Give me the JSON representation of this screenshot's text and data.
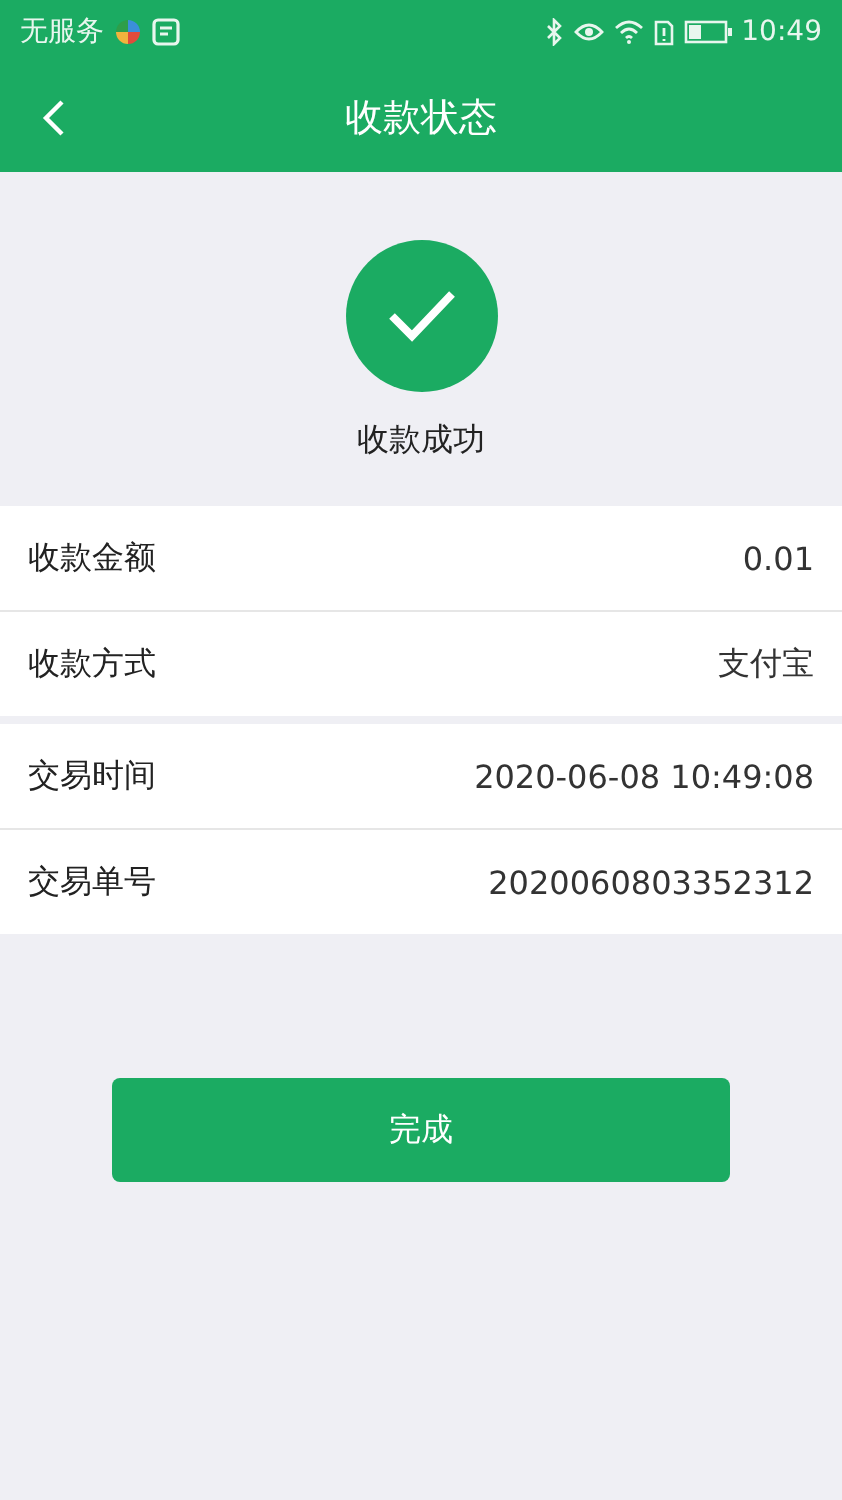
{
  "status_bar": {
    "carrier": "无服务",
    "time": "10:49"
  },
  "header": {
    "title": "收款状态"
  },
  "result": {
    "text": "收款成功"
  },
  "sections": [
    {
      "rows": [
        {
          "label": "收款金额",
          "value": "0.01"
        },
        {
          "label": "收款方式",
          "value": "支付宝"
        }
      ]
    },
    {
      "rows": [
        {
          "label": "交易时间",
          "value": "2020-06-08 10:49:08"
        },
        {
          "label": "交易单号",
          "value": "2020060803352312"
        }
      ]
    }
  ],
  "button": {
    "label": "完成"
  }
}
